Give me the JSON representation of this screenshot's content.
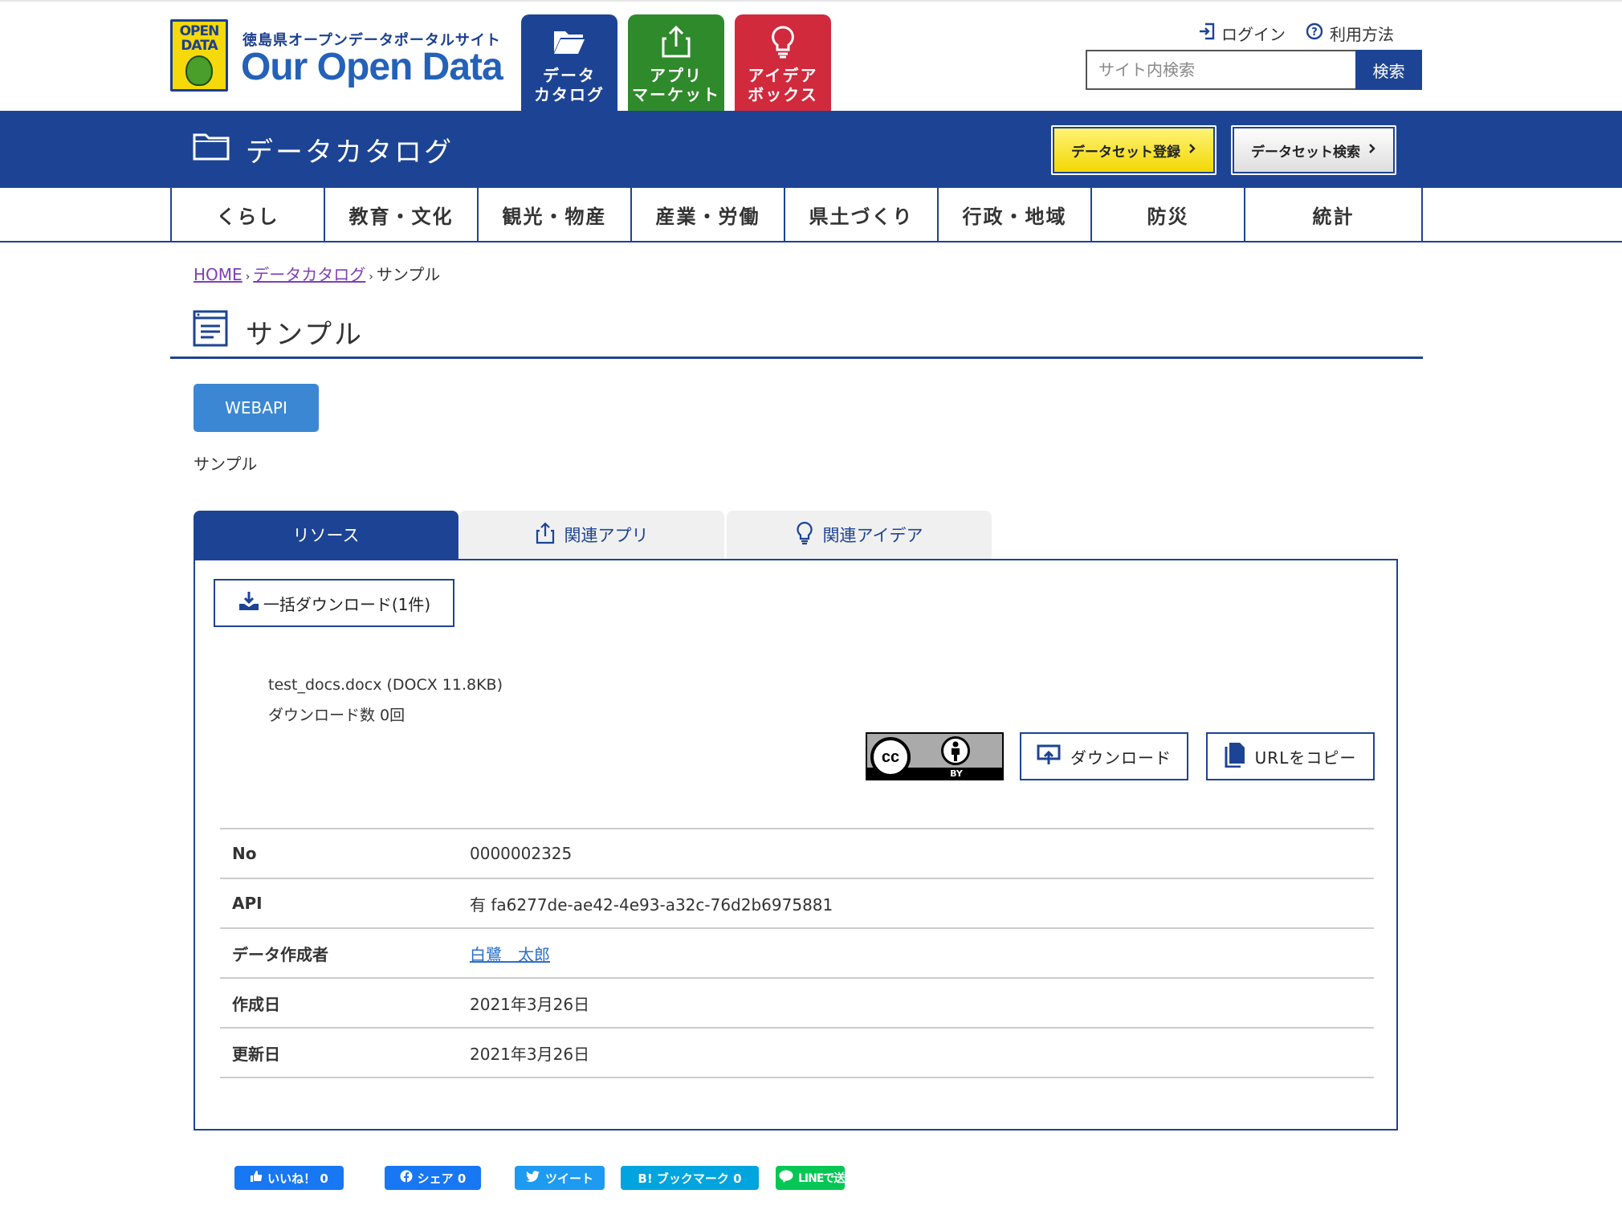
{
  "logo": {
    "badge_line1": "OPEN",
    "badge_line2": "DATA",
    "subtitle": "徳島県オープンデータポータルサイト",
    "title": "Our Open Data"
  },
  "nav": {
    "catalog": {
      "line1": "データ",
      "line2": "カタログ",
      "icon": "folder-open-icon"
    },
    "app": {
      "line1": "アプリ",
      "line2": "マーケット",
      "icon": "share-upload-icon"
    },
    "idea": {
      "line1": "アイデア",
      "line2": "ボックス",
      "icon": "lightbulb-icon"
    }
  },
  "header": {
    "login_label": "ログイン",
    "help_label": "利用方法",
    "search_placeholder": "サイト内検索",
    "search_button": "検索"
  },
  "band": {
    "title": "データカタログ",
    "register_button": "データセット登録",
    "search_button": "データセット検索"
  },
  "categories": [
    "くらし",
    "教育・文化",
    "観光・物産",
    "産業・労働",
    "県土づくり",
    "行政・地域",
    "防災",
    "統計"
  ],
  "breadcrumb": {
    "home": "HOME",
    "catalog": "データカタログ",
    "current": "サンプル"
  },
  "page": {
    "title": "サンプル",
    "tag": "WEBAPI",
    "description": "サンプル"
  },
  "tabs": {
    "resources": "リソース",
    "related_apps": "関連アプリ",
    "related_ideas": "関連アイデア"
  },
  "resource": {
    "bulk_download": "一括ダウンロード(1件)",
    "file_name": "test_docs.docx (DOCX 11.8KB)",
    "download_count": "ダウンロード数 0回",
    "license_badge": "BY",
    "license_cc": "cc",
    "download_button": "ダウンロード",
    "copy_url_button": "URLをコピー"
  },
  "meta": [
    {
      "key": "No",
      "value": "0000002325"
    },
    {
      "key": "API",
      "value": "有 fa6277de-ae42-4e93-a32c-76d2b6975881"
    },
    {
      "key": "データ作成者",
      "value": "白鷺　太郎"
    },
    {
      "key": "作成日",
      "value": "2021年3月26日"
    },
    {
      "key": "更新日",
      "value": "2021年3月26日"
    }
  ],
  "social": {
    "like": "いいね！ 0",
    "share": "シェア 0",
    "tweet": "ツイート",
    "hatena": "B! ブックマーク 0",
    "line": "LINEで送る"
  },
  "colors": {
    "primary": "#1d4494",
    "app_green": "#2f8a2b",
    "idea_red": "#d02a3c",
    "tag_blue": "#3b87d3",
    "register_yellow": "#f2d600"
  }
}
